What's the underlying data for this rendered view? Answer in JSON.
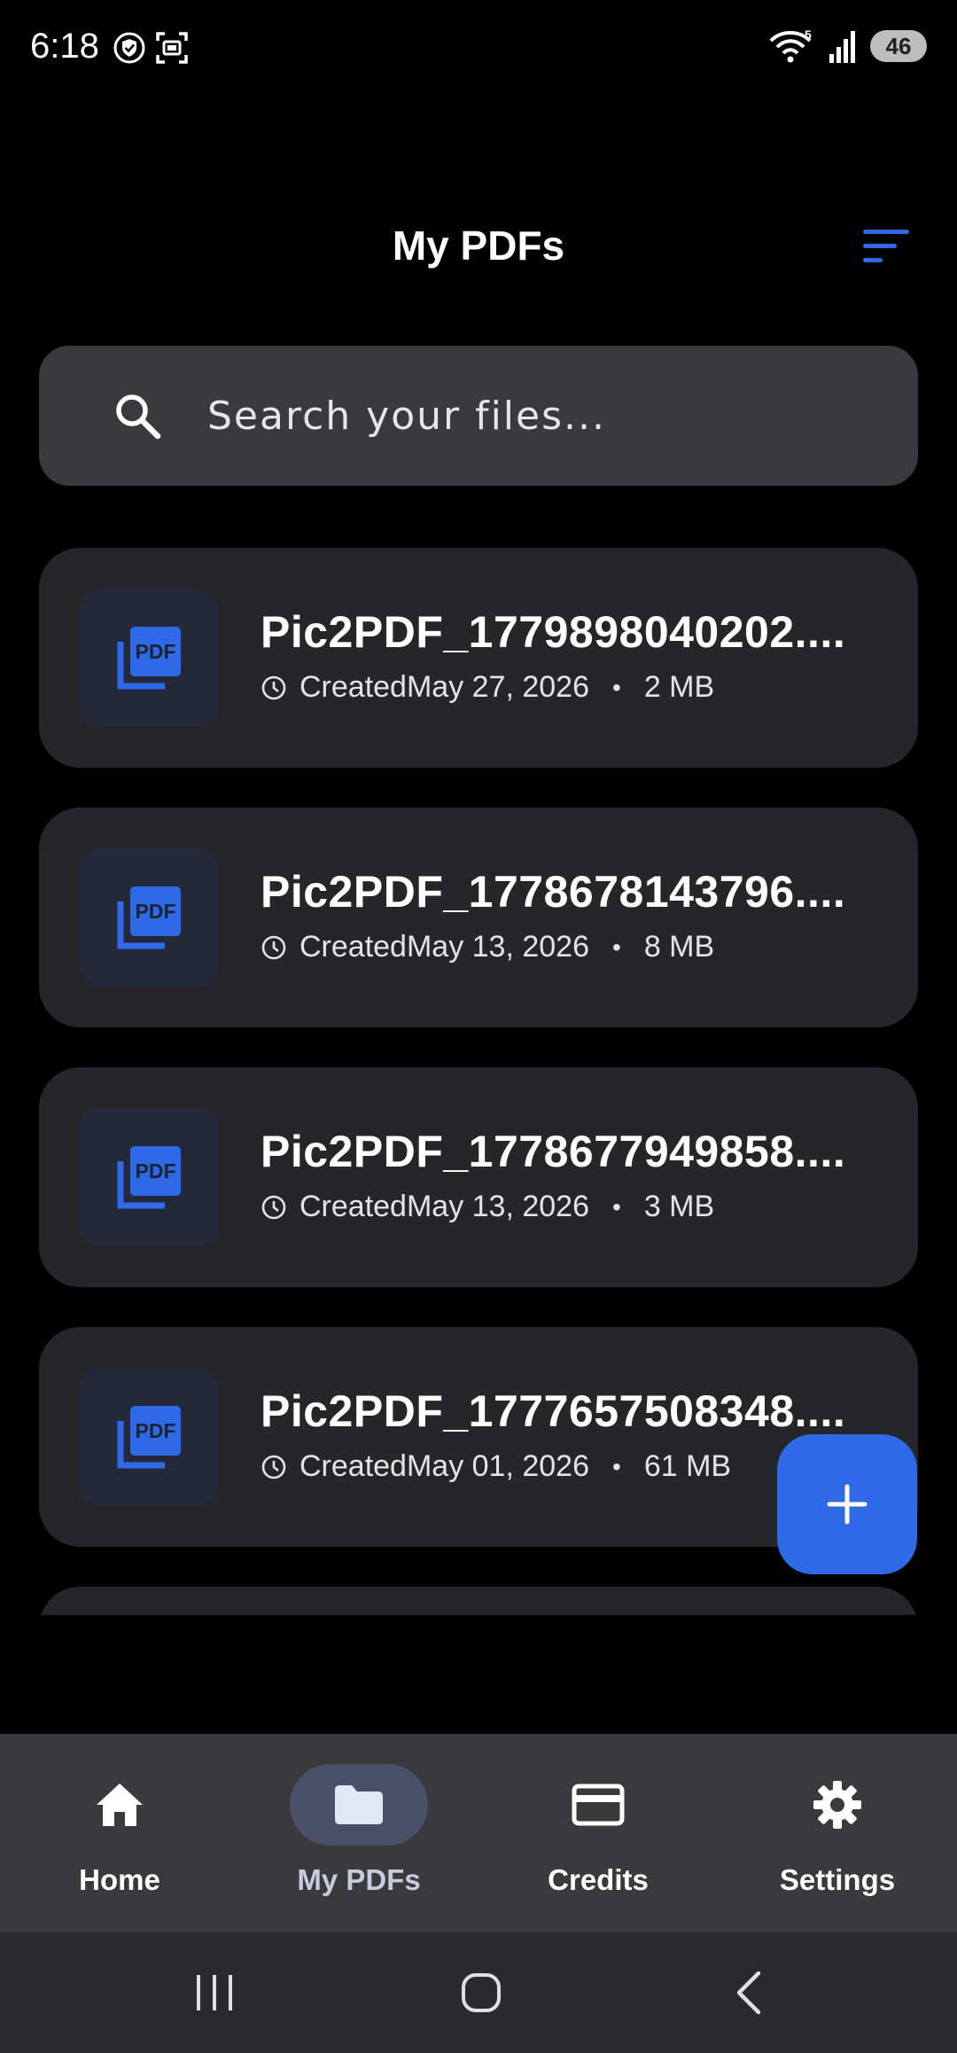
{
  "status_bar": {
    "time": "6:18",
    "battery": "46",
    "icons": [
      "shield-check-icon",
      "screenshot-icon",
      "wifi-icon",
      "signal-icon",
      "battery-icon"
    ]
  },
  "header": {
    "title": "My PDFs",
    "sort_icon": "sort-icon"
  },
  "search": {
    "placeholder": "Search your files..."
  },
  "files": [
    {
      "name": "Pic2PDF_1779898040202....",
      "created_label": "Created",
      "date": "May 27, 2026",
      "size": "2 MB"
    },
    {
      "name": "Pic2PDF_1778678143796....",
      "created_label": "Created",
      "date": "May 13, 2026",
      "size": "8 MB"
    },
    {
      "name": "Pic2PDF_1778677949858....",
      "created_label": "Created",
      "date": "May 13, 2026",
      "size": "3 MB"
    },
    {
      "name": "Pic2PDF_1777657508348....",
      "created_label": "Created",
      "date": "May 01, 2026",
      "size": "61 MB"
    }
  ],
  "fab": {
    "icon": "plus-icon"
  },
  "bottom_nav": {
    "items": [
      {
        "label": "Home",
        "icon": "home-icon",
        "active": false
      },
      {
        "label": "My PDFs",
        "icon": "folder-icon",
        "active": true
      },
      {
        "label": "Credits",
        "icon": "credit-card-icon",
        "active": false
      },
      {
        "label": "Settings",
        "icon": "gear-icon",
        "active": false
      }
    ]
  },
  "colors": {
    "accent": "#2e6ae8",
    "background": "#000000",
    "card": "#262628",
    "nav_bar": "#3a3a3c"
  }
}
